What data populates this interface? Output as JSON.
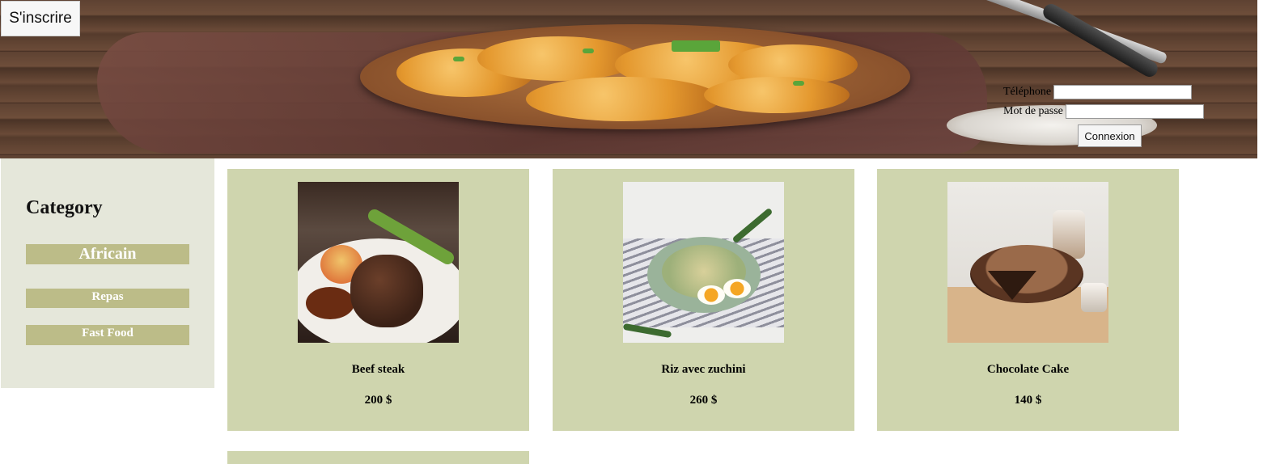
{
  "header": {
    "signup_label": "S'inscrire",
    "login": {
      "phone_label": "Téléphone",
      "phone_value": "",
      "password_label": "Mot de passe",
      "password_value": "",
      "submit_label": "Connexion"
    }
  },
  "sidebar": {
    "title": "Category",
    "items": [
      {
        "label": "Africain"
      },
      {
        "label": "Repas"
      },
      {
        "label": "Fast Food"
      }
    ]
  },
  "products": [
    {
      "name": "Beef steak",
      "price": "200 $"
    },
    {
      "name": "Riz avec zuchini",
      "price": "260 $"
    },
    {
      "name": "Chocolate Cake",
      "price": "140 $"
    }
  ],
  "colors": {
    "sidebar_bg": "#e5e7da",
    "category_item_bg": "#bcbc88",
    "card_bg": "#cfd5ae"
  }
}
